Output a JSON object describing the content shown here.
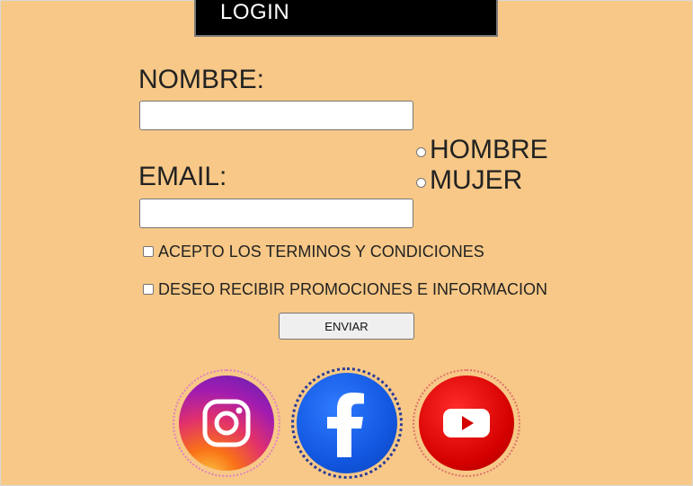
{
  "header": {
    "title": "LOGIN"
  },
  "form": {
    "name_label": "NOMBRE:",
    "name_value": "",
    "email_label": "EMAIL:",
    "email_value": "",
    "gender_options": [
      "HOMBRE",
      "MUJER"
    ],
    "terms_label": "ACEPTO LOS TERMINOS Y CONDICIONES",
    "promo_label": "DESEO RECIBIR PROMOCIONES E INFORMACION",
    "submit_label": "ENVIAR"
  },
  "social": [
    {
      "icon": "instagram-icon",
      "color": "#e1306c"
    },
    {
      "icon": "facebook-icon",
      "color": "#1877f2"
    },
    {
      "icon": "youtube-icon",
      "color": "#ff0000"
    }
  ],
  "colors": {
    "background": "#f7c887",
    "header": "#000000"
  }
}
